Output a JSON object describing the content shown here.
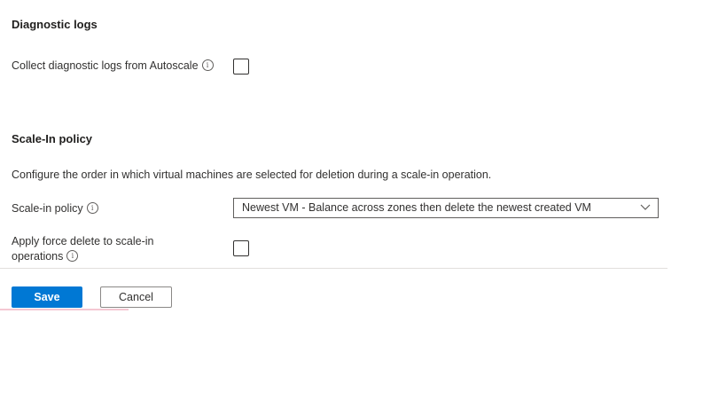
{
  "diagnostic_logs": {
    "title": "Diagnostic logs",
    "collect_label": "Collect diagnostic logs from Autoscale",
    "collect_checked": false
  },
  "scale_in": {
    "title": "Scale-In policy",
    "description": "Configure the order in which virtual machines are selected for deletion during a scale-in operation.",
    "policy_label": "Scale-in policy",
    "policy_value": "Newest VM - Balance across zones then delete the newest created VM",
    "force_delete_label_line1": "Apply force delete to scale-in",
    "force_delete_label_line2": "operations",
    "force_delete_checked": false
  },
  "footer": {
    "save_label": "Save",
    "cancel_label": "Cancel"
  },
  "icons": {
    "info_glyph": "i",
    "chevron": "chevron-down-icon"
  },
  "colors": {
    "primary": "#0078d4",
    "text": "#323130",
    "divider": "#e1dfdd"
  }
}
